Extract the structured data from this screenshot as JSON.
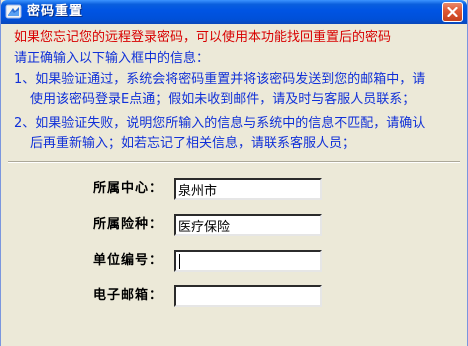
{
  "window": {
    "title": "密码重置",
    "icon": "app-icon",
    "close_icon": "close-icon"
  },
  "messages": {
    "intro": "如果您忘记您的远程登录密码，可以使用本功能找回重置后的密码",
    "instruction": "请正确输入以下输入框中的信息：",
    "item1_line1": "1、如果验证通过，系统会将密码重置并将该密码发送到您的邮箱中，请",
    "item1_line2": "使用该密码登录E点通；假如未收到邮件，请及时与客服人员联系；",
    "item2_line1": "2、如果验证失败，说明您所输入的信息与系统中的信息不匹配，请确认",
    "item2_line2": "后再重新输入；如若忘记了相关信息，请联系客服人员；"
  },
  "form": {
    "center_label": "所属中心：",
    "center_value": "泉州市",
    "insurance_label": "所属险种：",
    "insurance_value": "医疗保险",
    "unit_label": "单位编号：",
    "unit_value": "",
    "email_label": "电子邮箱：",
    "email_value": ""
  },
  "colors": {
    "title_bar": "#0054e3",
    "intro_text": "#d80000",
    "instruction_text": "#1030d8",
    "window_bg": "#ece9d8"
  }
}
